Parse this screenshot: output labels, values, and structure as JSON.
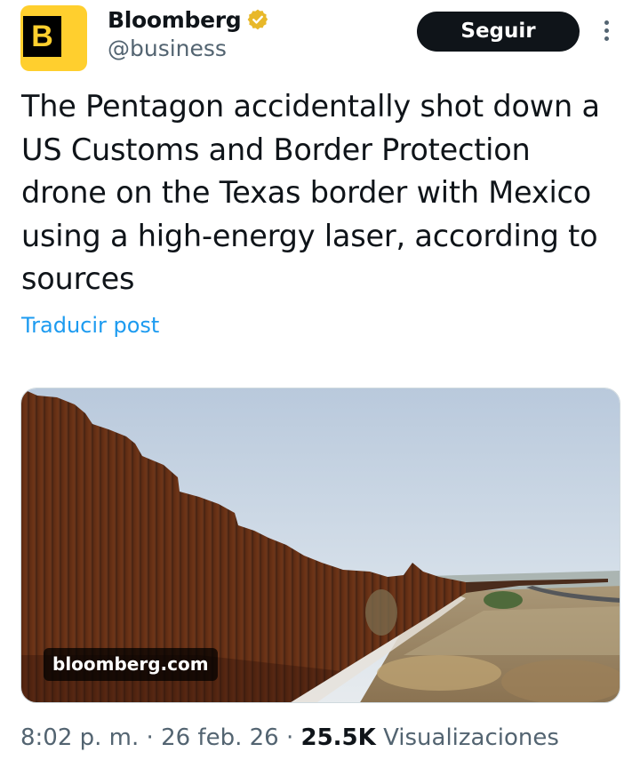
{
  "author": {
    "avatar_letter": "B",
    "display_name": "Bloomberg",
    "handle": "@business",
    "verified_badge_icon": "verified-gold-badge-icon",
    "verified_color": "#e8b829"
  },
  "actions": {
    "follow_label": "Seguir",
    "more_icon": "more-vertical-icon"
  },
  "tweet": {
    "text": "The Pentagon accidentally shot down a US Customs and Border Protection drone on the Texas border with Mexico using a high-energy laser, according to sources",
    "translate_label": "Traducir post"
  },
  "media": {
    "domain": "bloomberg.com"
  },
  "meta": {
    "time": "8:02 p. m.",
    "separator": "·",
    "date": "26 feb. 26",
    "views_count": "25.5K",
    "views_label": "Visualizaciones"
  },
  "colors": {
    "link": "#1d9bf0",
    "secondary_text": "#536471",
    "brand_yellow": "#ffcf2e"
  }
}
